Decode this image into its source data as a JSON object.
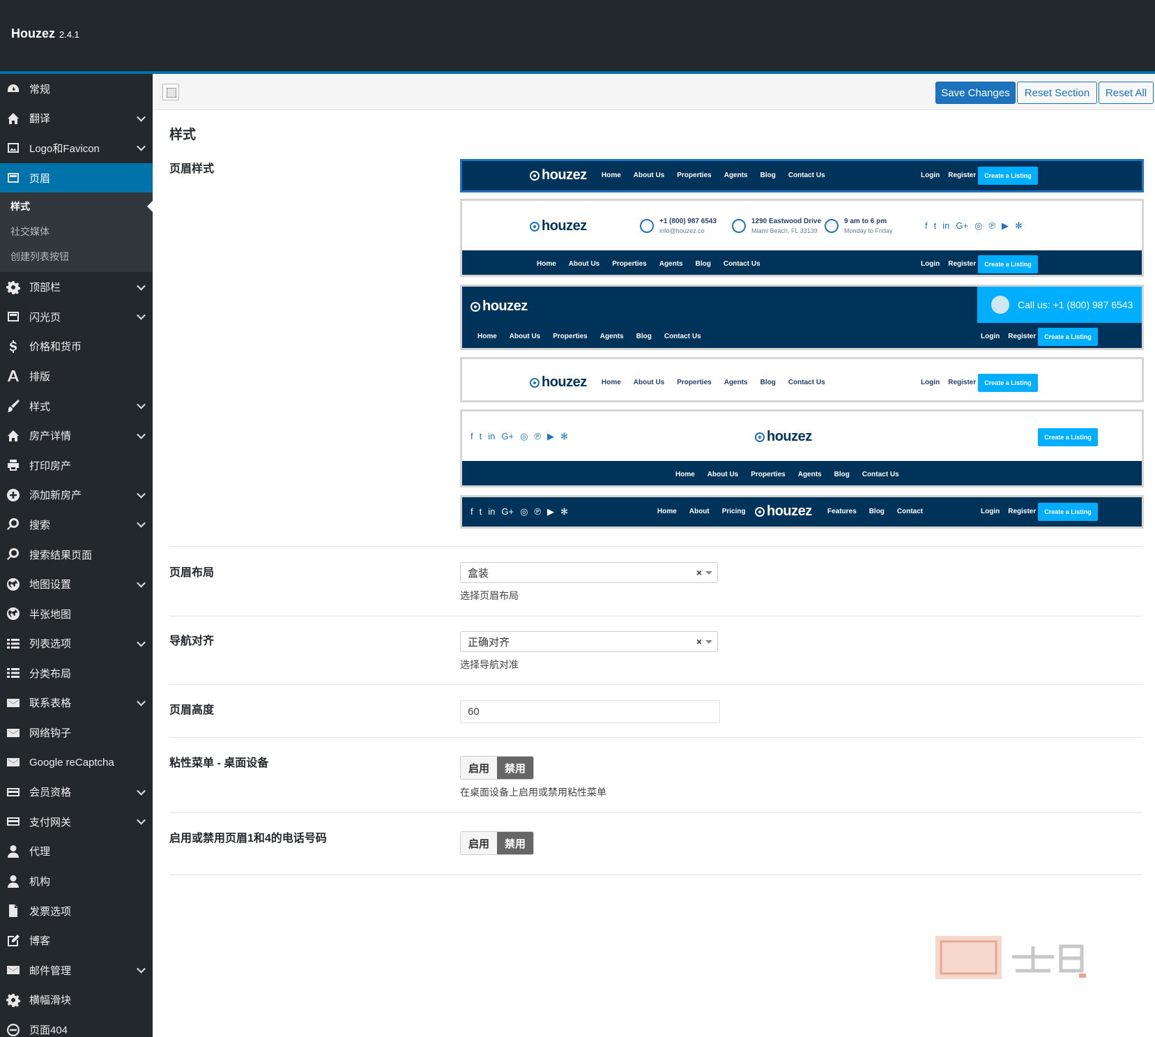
{
  "app": {
    "name": "Houzez",
    "version": "2.4.1"
  },
  "toolbar": {
    "save_label": "Save Changes",
    "reset_section_label": "Reset Section",
    "reset_all_label": "Reset All"
  },
  "sidebar": {
    "items": [
      {
        "label": "常规",
        "icon": "dashboard-icon",
        "chevron": false
      },
      {
        "label": "翻译",
        "icon": "home-icon",
        "chevron": true
      },
      {
        "label": "Logo和Favicon",
        "icon": "image-icon",
        "chevron": true
      },
      {
        "label": "页眉",
        "icon": "layout-icon",
        "chevron": false,
        "active": true
      },
      {
        "label": "顶部栏",
        "icon": "gear-icon",
        "chevron": true
      },
      {
        "label": "闪光页",
        "icon": "layout-icon",
        "chevron": true
      },
      {
        "label": "价格和货币",
        "icon": "dollar-icon",
        "chevron": false
      },
      {
        "label": "排版",
        "icon": "font-icon",
        "chevron": false
      },
      {
        "label": "样式",
        "icon": "brush-icon",
        "chevron": true
      },
      {
        "label": "房产详情",
        "icon": "home-icon",
        "chevron": true
      },
      {
        "label": "打印房产",
        "icon": "print-icon",
        "chevron": false
      },
      {
        "label": "添加新房产",
        "icon": "plus-circle-icon",
        "chevron": true
      },
      {
        "label": "搜索",
        "icon": "search-icon",
        "chevron": true
      },
      {
        "label": "搜索结果页面",
        "icon": "search-icon",
        "chevron": false
      },
      {
        "label": "地图设置",
        "icon": "globe-icon",
        "chevron": true
      },
      {
        "label": "半张地图",
        "icon": "globe-icon",
        "chevron": false
      },
      {
        "label": "列表选项",
        "icon": "list-icon",
        "chevron": true
      },
      {
        "label": "分类布局",
        "icon": "list-icon",
        "chevron": false
      },
      {
        "label": "联系表格",
        "icon": "envelope-icon",
        "chevron": true
      },
      {
        "label": "网络钩子",
        "icon": "envelope-icon",
        "chevron": false
      },
      {
        "label": "Google reCaptcha",
        "icon": "envelope-icon",
        "chevron": false
      },
      {
        "label": "会员资格",
        "icon": "card-icon",
        "chevron": true
      },
      {
        "label": "支付网关",
        "icon": "card-icon",
        "chevron": true
      },
      {
        "label": "代理",
        "icon": "user-icon",
        "chevron": false
      },
      {
        "label": "机构",
        "icon": "user-icon",
        "chevron": false
      },
      {
        "label": "发票选项",
        "icon": "document-icon",
        "chevron": false
      },
      {
        "label": "博客",
        "icon": "edit-icon",
        "chevron": false
      },
      {
        "label": "邮件管理",
        "icon": "envelope-icon",
        "chevron": true
      },
      {
        "label": "横幅滑块",
        "icon": "gear-icon",
        "chevron": false
      },
      {
        "label": "页面404",
        "icon": "minus-circle-icon",
        "chevron": false
      }
    ],
    "submenu": [
      "样式",
      "社交媒体",
      "创建列表按钮"
    ]
  },
  "section": {
    "title": "样式"
  },
  "header_style": {
    "label": "页眉样式",
    "menu": [
      "Home",
      "About Us",
      "Properties",
      "Agents",
      "Blog",
      "Contact Us"
    ],
    "menu6_left": [
      "Home",
      "About",
      "Pricing"
    ],
    "menu6_right": [
      "Features",
      "Blog",
      "Contact"
    ],
    "logo": "houzez",
    "login": "Login",
    "register": "Register",
    "create": "Create a Listing",
    "phone": "+1 (800) 987 6543",
    "email": "info@houzez.co",
    "address1": "1290 Eastwood Drive",
    "address2": "Miami Beach, FL 33139",
    "hours1": "9 am to 6 pm",
    "hours2": "Monday to Friday",
    "callus": "Call us: +1 (800) 987 6543",
    "social_icons": [
      "facebook-icon",
      "twitter-icon",
      "linkedin-icon",
      "googleplus-icon",
      "instagram-icon",
      "pinterest-icon",
      "youtube-icon",
      "yelp-icon"
    ]
  },
  "layout": {
    "label": "页眉布局",
    "value": "盒装",
    "hint": "选择页眉布局"
  },
  "nav_align": {
    "label": "导航对齐",
    "value": "正确对齐",
    "hint": "选择导航对准"
  },
  "height": {
    "label": "页眉高度",
    "value": "60"
  },
  "sticky": {
    "label": "粘性菜单 - 桌面设备",
    "on": "启用",
    "off": "禁用",
    "hint": "在桌面设备上启用或禁用粘性菜单"
  },
  "phone_toggle": {
    "label": "启用或禁用页眉1和4的电话号码",
    "on": "启用",
    "off": "禁用"
  },
  "colors": {
    "sidebar_bg": "#23282d",
    "accent": "#0073aa",
    "header_navy": "#00335a",
    "cta": "#00aeff"
  }
}
